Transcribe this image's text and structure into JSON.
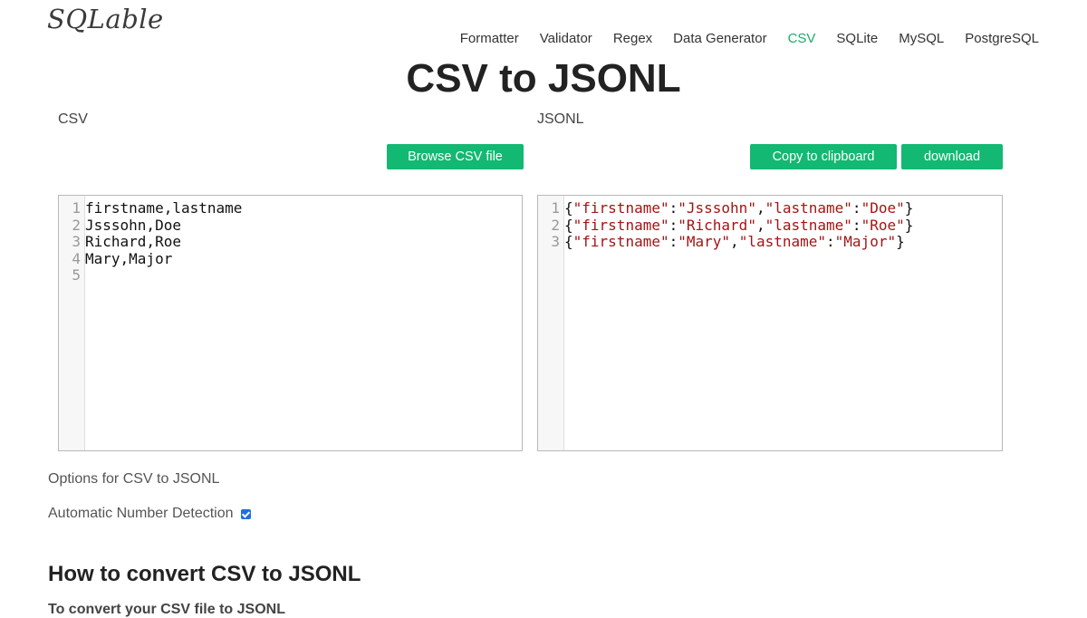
{
  "logo": "SQLable",
  "nav": [
    {
      "label": "Formatter",
      "active": false
    },
    {
      "label": "Validator",
      "active": false
    },
    {
      "label": "Regex",
      "active": false
    },
    {
      "label": "Data Generator",
      "active": false
    },
    {
      "label": "CSV",
      "active": true
    },
    {
      "label": "SQLite",
      "active": false
    },
    {
      "label": "MySQL",
      "active": false
    },
    {
      "label": "PostgreSQL",
      "active": false
    }
  ],
  "page_title": "CSV to JSONL",
  "left": {
    "label": "CSV",
    "browse_button": "Browse CSV file",
    "lines": [
      "firstname,lastname",
      "Jsssohn,Doe",
      "Richard,Roe",
      "Mary,Major",
      ""
    ]
  },
  "right": {
    "label": "JSONL",
    "copy_button": "Copy to clipboard",
    "download_button": "download",
    "records": [
      {
        "firstname": "Jsssohn",
        "lastname": "Doe"
      },
      {
        "firstname": "Richard",
        "lastname": "Roe"
      },
      {
        "firstname": "Mary",
        "lastname": "Major"
      }
    ]
  },
  "options": {
    "title": "Options for CSV to JSONL",
    "auto_number_label": "Automatic Number Detection",
    "auto_number_checked": true
  },
  "howto": {
    "title": "How to convert CSV to JSONL",
    "partial_text": "To convert your CSV file to JSONL"
  },
  "colors": {
    "accent": "#13b872",
    "nav_active": "#1aab6f",
    "string": "#a31515",
    "checkbox": "#1f6fe0"
  }
}
